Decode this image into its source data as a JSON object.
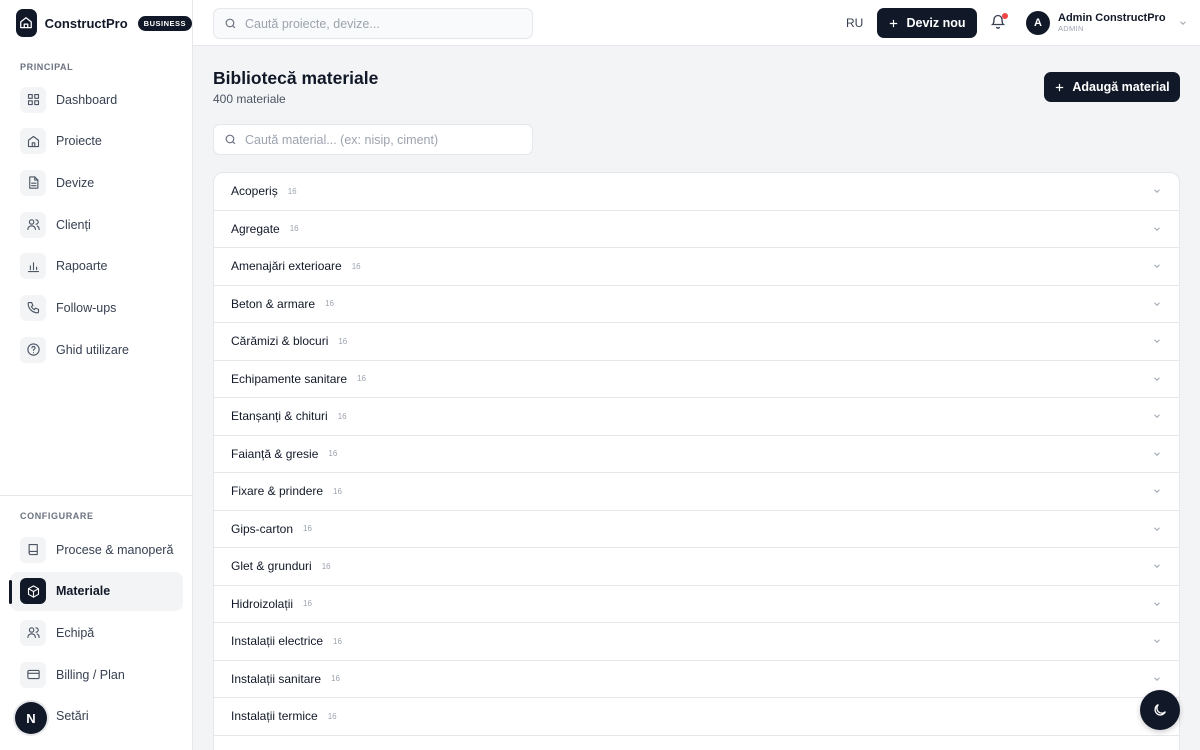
{
  "brand": {
    "name": "ConstructPro",
    "badge": "BUSINESS"
  },
  "sidebar": {
    "principal_label": "PRINCIPAL",
    "principal": [
      {
        "label": "Dashboard",
        "icon": "grid-icon"
      },
      {
        "label": "Proiecte",
        "icon": "home-icon"
      },
      {
        "label": "Devize",
        "icon": "document-icon"
      },
      {
        "label": "Clienți",
        "icon": "users-icon"
      },
      {
        "label": "Rapoarte",
        "icon": "bar-chart-icon"
      },
      {
        "label": "Follow-ups",
        "icon": "phone-icon"
      },
      {
        "label": "Ghid utilizare",
        "icon": "help-circle-icon"
      }
    ],
    "config_label": "CONFIGURARE",
    "config": [
      {
        "label": "Procese & manoperă",
        "icon": "book-icon"
      },
      {
        "label": "Materiale",
        "icon": "box-icon",
        "active": true
      },
      {
        "label": "Echipă",
        "icon": "users-icon"
      },
      {
        "label": "Billing / Plan",
        "icon": "credit-card-icon"
      },
      {
        "label": "Setări",
        "icon": "gear-icon"
      }
    ],
    "avatar_letter": "N"
  },
  "topbar": {
    "search_placeholder": "Caută proiecte, devize...",
    "lang": "RU",
    "new_button": "Deviz nou",
    "user": {
      "initial": "A",
      "name": "Admin ConstructPro",
      "role": "ADMIN"
    }
  },
  "main": {
    "title": "Bibliotecă materiale",
    "subtitle": "400 materiale",
    "add_button": "Adaugă material",
    "search_placeholder": "Caută material... (ex: nisip, ciment)",
    "categories": [
      {
        "name": "Acoperiș",
        "count": "16"
      },
      {
        "name": "Agregate",
        "count": "16"
      },
      {
        "name": "Amenajări exterioare",
        "count": "16"
      },
      {
        "name": "Beton & armare",
        "count": "16"
      },
      {
        "name": "Cărămizi & blocuri",
        "count": "16"
      },
      {
        "name": "Echipamente sanitare",
        "count": "16"
      },
      {
        "name": "Etanșanți & chituri",
        "count": "16"
      },
      {
        "name": "Faianță & gresie",
        "count": "16"
      },
      {
        "name": "Fixare & prindere",
        "count": "16"
      },
      {
        "name": "Gips-carton",
        "count": "16"
      },
      {
        "name": "Glet & grunduri",
        "count": "16"
      },
      {
        "name": "Hidroizolații",
        "count": "16"
      },
      {
        "name": "Instalații electrice",
        "count": "16"
      },
      {
        "name": "Instalații sanitare",
        "count": "16"
      },
      {
        "name": "Instalații termice",
        "count": "16"
      }
    ]
  },
  "colors": {
    "primary": "#111827",
    "background": "#f3f4f6",
    "notification": "#ef4444"
  }
}
